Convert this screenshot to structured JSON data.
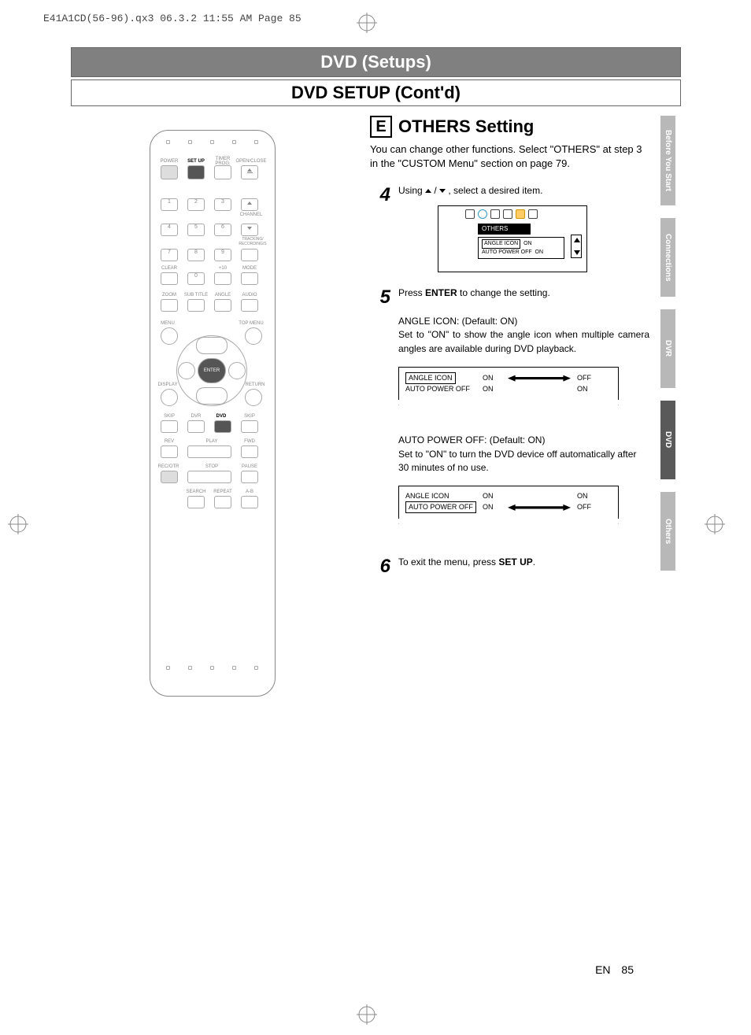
{
  "header": {
    "jobinfo": "E41A1CD(56-96).qx3  06.3.2 11:55 AM  Page 85"
  },
  "titles": {
    "main": "DVD (Setups)",
    "sub": "DVD SETUP (Cont'd)"
  },
  "tabs": [
    {
      "label": "Before You Start",
      "active": false
    },
    {
      "label": "Connections",
      "active": false
    },
    {
      "label": "DVR",
      "active": false
    },
    {
      "label": "DVD",
      "active": true
    },
    {
      "label": "Others",
      "active": false
    }
  ],
  "section": {
    "letter": "E",
    "title": "OTHERS Setting",
    "intro": "You can change other functions. Select \"OTHERS\" at step 3 in the \"CUSTOM Menu\" section on page 79."
  },
  "steps": {
    "s4": {
      "num": "4",
      "text_before": "Using ",
      "text_after": ", select a desired item."
    },
    "s5": {
      "num": "5",
      "text1a": "Press ",
      "text1b": "ENTER",
      "text1c": " to change the setting.",
      "angle_title": "ANGLE ICON: (Default: ON)",
      "angle_desc": "Set to \"ON\" to show the angle icon when multiple camera angles are available during DVD playback.",
      "auto_title": "AUTO POWER OFF: (Default: ON)",
      "auto_desc": "Set to \"ON\" to turn the DVD device off automatically after 30 minutes of no use."
    },
    "s6": {
      "num": "6",
      "text_a": "To exit the  menu, press ",
      "text_b": "SET UP",
      "text_c": "."
    }
  },
  "osd": {
    "title": "OTHERS",
    "rows": [
      {
        "label": "ANGLE ICON",
        "value": "ON",
        "selected": true
      },
      {
        "label": "AUTO POWER OFF",
        "value": "ON",
        "selected": false
      }
    ]
  },
  "torn1": {
    "rows": [
      {
        "label": "ANGLE ICON",
        "boxed": true,
        "val": "ON",
        "opt1": "OFF",
        "opt2": "ON"
      },
      {
        "label": "AUTO POWER OFF",
        "boxed": false,
        "val": "ON",
        "opt1": "",
        "opt2": ""
      }
    ]
  },
  "torn2": {
    "rows": [
      {
        "label": "ANGLE ICON",
        "boxed": false,
        "val": "ON",
        "opt1": "ON",
        "opt2": "OFF"
      },
      {
        "label": "AUTO POWER OFF",
        "boxed": true,
        "val": "ON",
        "opt1": "",
        "opt2": ""
      }
    ]
  },
  "remote": {
    "labels": {
      "power": "POWER",
      "setup": "SET UP",
      "timer": "TIMER\nPROG.",
      "open": "OPEN/CLOSE",
      "channel": "CHANNEL",
      "trksrch": "TRACKING/\nRECORDING/S",
      "clear": "CLEAR",
      "p10": "+10",
      "mode": "MODE",
      "zoom": "ZOOM",
      "subtitle": "SUB TITLE",
      "angle": "ANGLE",
      "audio": "AUDIO",
      "menu": "MENU",
      "topmenu": "TOP MENU",
      "enter": "ENTER",
      "display": "DISPLAY",
      "return": "RETURN",
      "skip_l": "SKIP",
      "dvr": "DVR",
      "dvd": "DVD",
      "skip_r": "SKIP",
      "rev": "REV",
      "play": "PLAY",
      "fwd": "FWD",
      "recotr": "REC/OTR",
      "stop": "STOP",
      "pause": "PAUSE",
      "search": "SEARCH",
      "repeat": "REPEAT",
      "ab": "A-B"
    },
    "digits": [
      "1",
      "2",
      "3",
      "4",
      "5",
      "6",
      "7",
      "8",
      "9",
      "0"
    ]
  },
  "footer": {
    "lang": "EN",
    "page": "85"
  }
}
